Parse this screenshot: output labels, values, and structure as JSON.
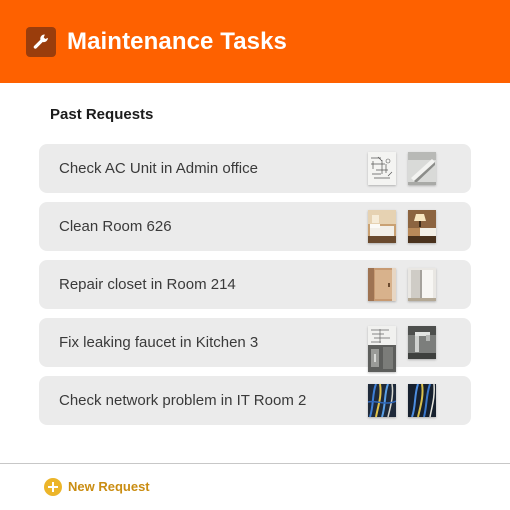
{
  "header": {
    "title": "Maintenance Tasks",
    "icon": "wrench-icon",
    "background": "#fe6100"
  },
  "section": {
    "title": "Past Requests"
  },
  "tasks": [
    {
      "label": "Check AC Unit in Admin office",
      "photos": [
        "sketch-photo",
        "ac-unit-photo"
      ]
    },
    {
      "label": "Clean Room 626",
      "photos": [
        "bedroom-photo",
        "bedroom-lamp-photo"
      ]
    },
    {
      "label": "Repair closet in Room 214",
      "photos": [
        "closet-door-photo",
        "closet-interior-photo"
      ]
    },
    {
      "label": "Fix leaking faucet in Kitchen 3",
      "photos": [
        "faucet-sketch-photo",
        "faucet-photo"
      ]
    },
    {
      "label": "Check network problem in IT Room 2",
      "photos": [
        "network-cables-photo",
        "network-cables-photo-2"
      ]
    }
  ],
  "footer": {
    "new_request_label": "New Request",
    "icon": "plus-circle-icon",
    "accent": "#ecb52a"
  }
}
